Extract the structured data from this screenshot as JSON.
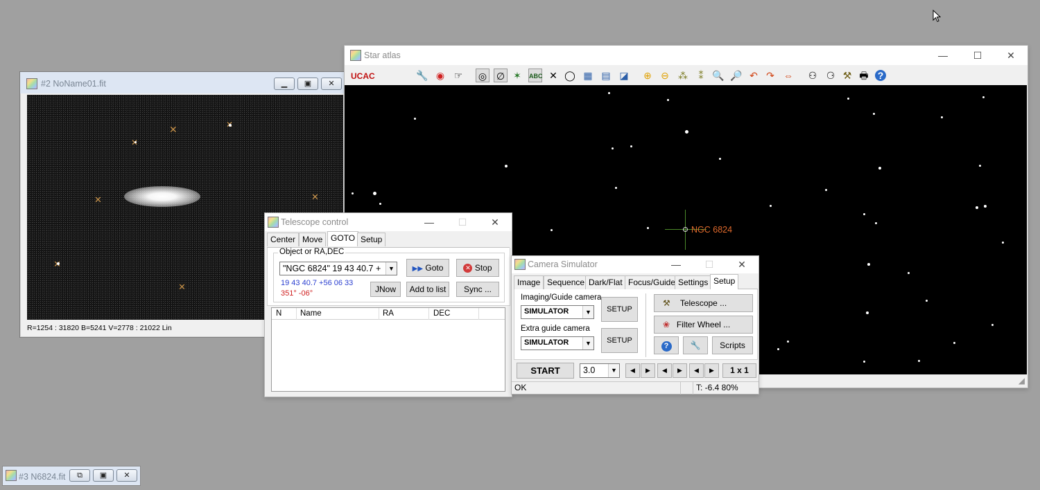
{
  "image_window": {
    "title": "#2 NoName01.fit",
    "status": "R=1254 : 31820    B=5241    V=2778 : 21022 Lin"
  },
  "minimized_window": {
    "title": "#3 N6824.fit"
  },
  "star_atlas": {
    "title": "Star atlas",
    "catalog_label": "UCAC",
    "target_label": "NGC 6824"
  },
  "telescope": {
    "title": "Telescope control",
    "tabs": [
      "Center",
      "Move",
      "GOTO",
      "Setup"
    ],
    "group_label": "Object or RA,DEC",
    "object_value": "\"NGC 6824\"   19 43 40.7  +",
    "coords": "19 43 40.7   +56 06 33",
    "altaz": "351°  -06°",
    "goto_label": "Goto",
    "stop_label": "Stop",
    "jnow_label": "JNow",
    "add_label": "Add to list",
    "sync_label": "Sync ...",
    "columns": [
      "N",
      "Name",
      "RA",
      "DEC"
    ]
  },
  "camera": {
    "title": "Camera Simulator",
    "tabs": [
      "Image",
      "Sequence",
      "Dark/Flat",
      "Focus/Guide",
      "Settings",
      "Setup"
    ],
    "imaging_label": "Imaging/Guide camera",
    "imaging_value": "SIMULATOR",
    "extra_label": "Extra guide camera",
    "extra_value": "SIMULATOR",
    "setup_label": "SETUP",
    "telescope_label": "Telescope ...",
    "filter_label": "Filter Wheel ...",
    "scripts_label": "Scripts",
    "start_label": "START",
    "exposure_value": "3.0",
    "binning_label": "1 x 1",
    "status_left": "OK",
    "status_right": "T: -6.4  80%"
  },
  "colors": {
    "desktop": "#a0a0a0",
    "target_label": "#e06a2c",
    "coords_blue": "#2b3fd0",
    "altaz_red": "#d02020",
    "catalog_red": "#c01010"
  }
}
